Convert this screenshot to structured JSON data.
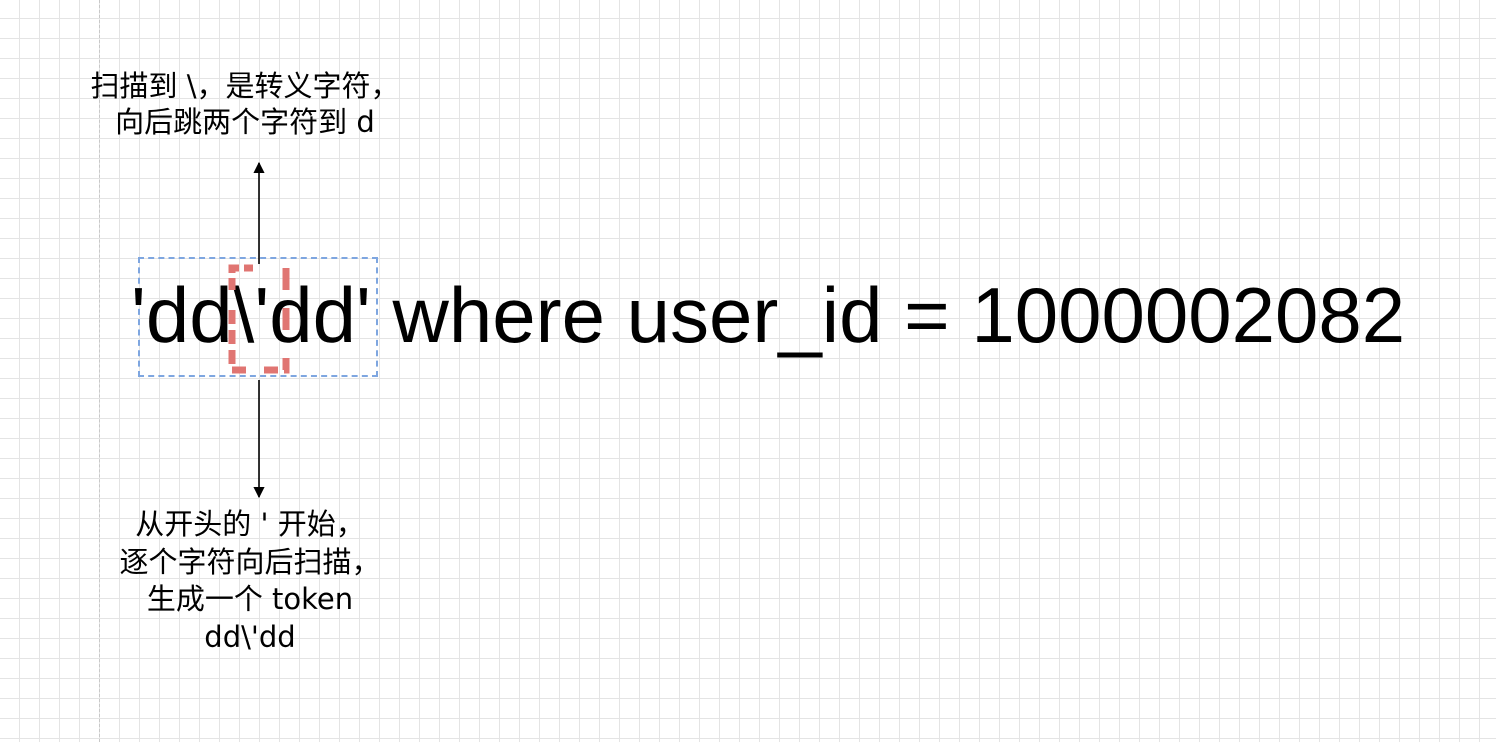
{
  "annotations": {
    "top_note": [
      "扫描到 \\，是转义字符，",
      "向后跳两个字符到 d"
    ],
    "bottom_note": [
      "从开头的 ' 开始，",
      "逐个字符向后扫描，",
      "生成一个 token",
      "dd\\'dd"
    ]
  },
  "statement": {
    "text": "'dd\\'dd' where user_id = 1000002082"
  },
  "colors": {
    "token_box": "#7ea6e0",
    "escape_highlight": "#e07572",
    "arrow": "#000000",
    "grid": "#e4e4e4"
  }
}
